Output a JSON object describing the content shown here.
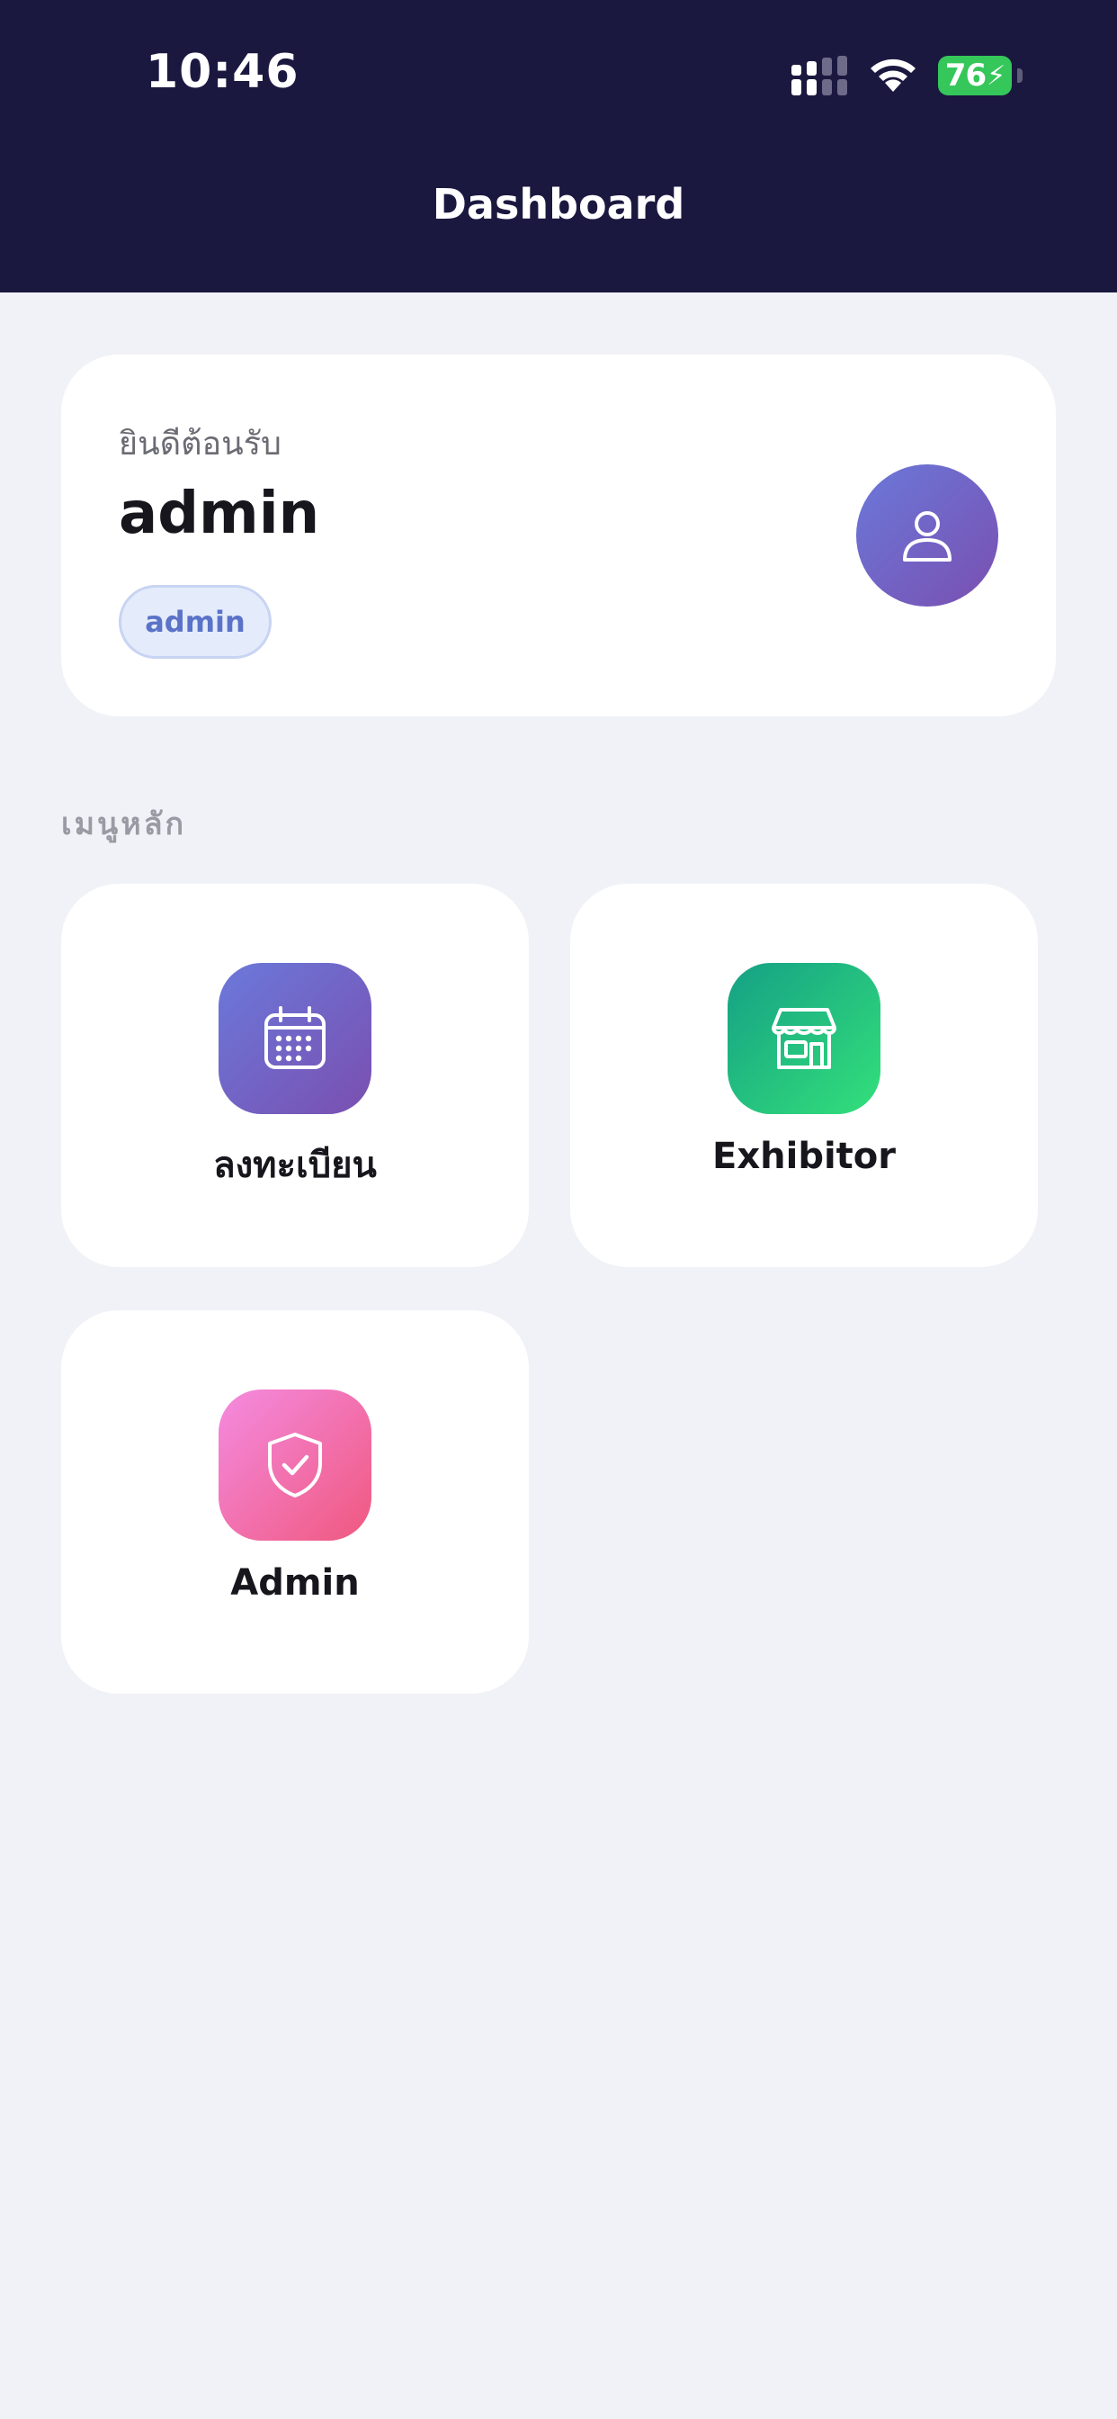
{
  "status_bar": {
    "time": "10:46",
    "battery_level": "76",
    "battery_charging": true,
    "icons": [
      "signal-icon",
      "wifi-icon",
      "battery-icon"
    ]
  },
  "header": {
    "title": "Dashboard",
    "background_color": "#1b1840"
  },
  "welcome": {
    "greeting": "ยินดีต้อนรับ",
    "name": "admin",
    "role_badge": "admin",
    "avatar_icon": "user-icon"
  },
  "menu": {
    "section_label": "เมนูหลัก",
    "items": [
      {
        "label": "ลงทะเบียน",
        "icon": "calendar-icon",
        "accent": "#6a79da"
      },
      {
        "label": "Exhibitor",
        "icon": "store-icon",
        "accent": "#1fb07e"
      },
      {
        "label": "Admin",
        "icon": "shield-check-icon",
        "accent": "#f06aa8"
      }
    ]
  }
}
